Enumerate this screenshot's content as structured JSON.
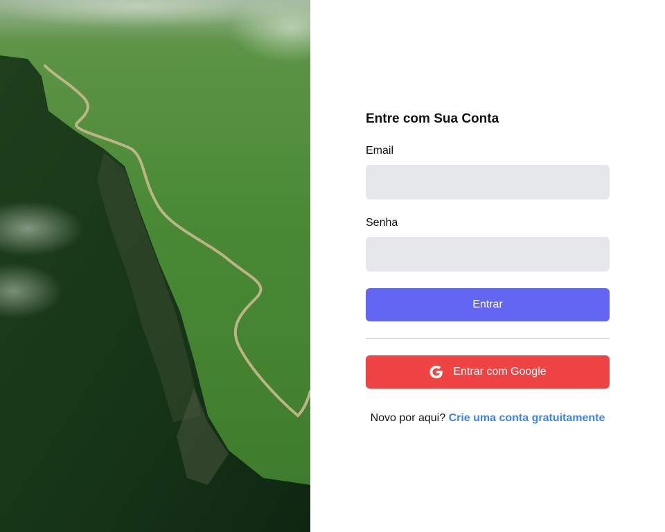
{
  "hero": {
    "image": "aerial-green-cliff-with-trail"
  },
  "form": {
    "title": "Entre com Sua Conta",
    "email_label": "Email",
    "email_value": "",
    "senha_label": "Senha",
    "senha_value": "",
    "submit_label": "Entrar",
    "google_label": "Entrar com Google",
    "google_icon": "google-icon",
    "signup_prompt": "Novo por aqui?",
    "signup_link": "Crie uma conta gratuitamente"
  },
  "colors": {
    "primary": "#6366f1",
    "google": "#ef4444",
    "link": "#3b82f6",
    "input_bg": "#e5e7eb"
  }
}
